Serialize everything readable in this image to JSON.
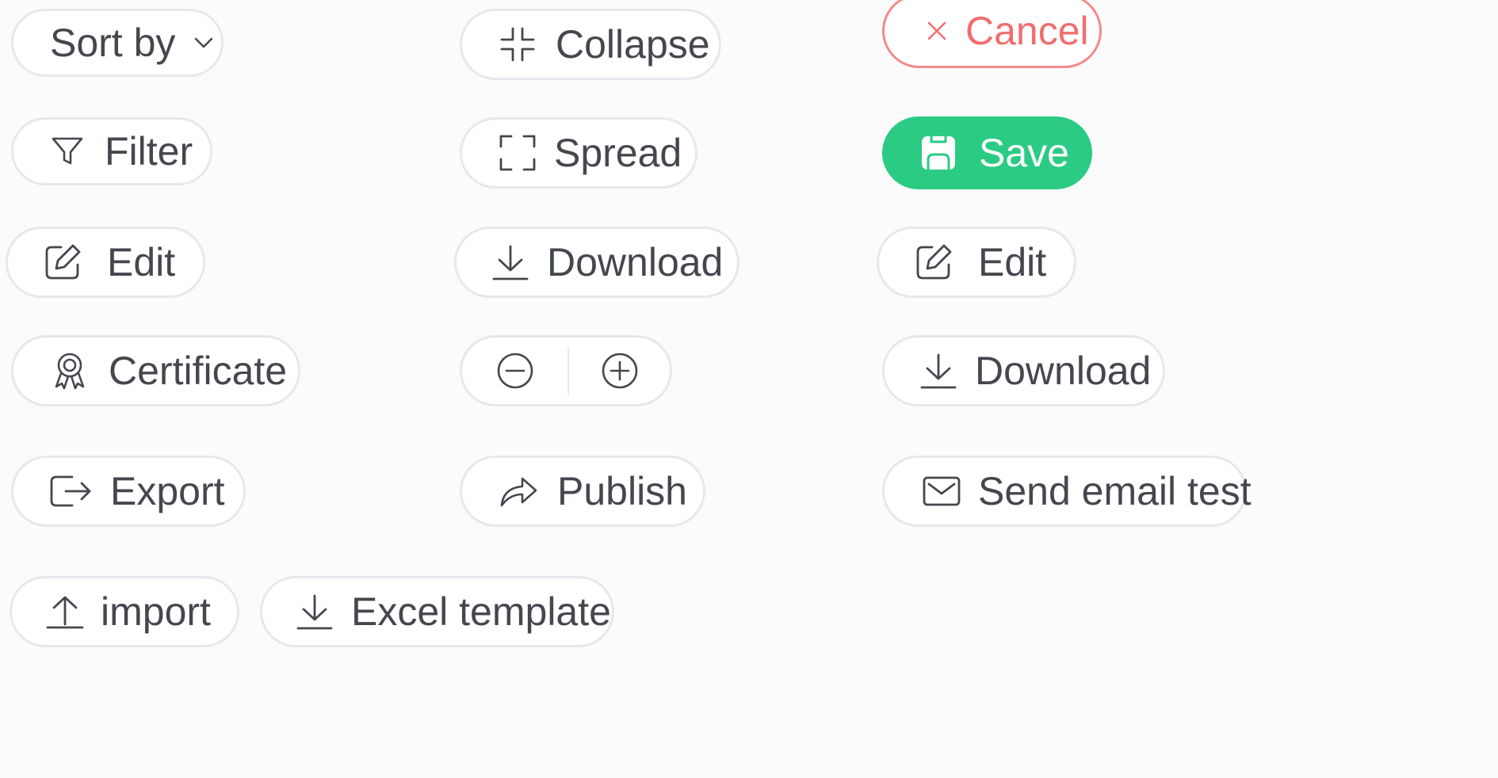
{
  "buttons": {
    "sort_by": "Sort by",
    "collapse": "Collapse",
    "cancel": "Cancel",
    "filter": "Filter",
    "spread": "Spread",
    "save": "Save",
    "edit_left": "Edit",
    "download_center": "Download",
    "edit_right": "Edit",
    "certificate": "Certificate",
    "download_right": "Download",
    "export": "Export",
    "publish": "Publish",
    "send_email_test": "Send email test",
    "import": "import",
    "excel_template": "Excel template"
  },
  "colors": {
    "background": "#fbfbfc",
    "border": "#e7e8ee",
    "text": "#45474f",
    "danger": "#f26d6d",
    "primary": "#2bcb83"
  },
  "icons": {
    "sort_by": "chevron-down-icon",
    "collapse": "collapse-icon",
    "cancel": "close-icon",
    "filter": "filter-icon",
    "spread": "expand-icon",
    "save": "save-icon",
    "edit": "edit-icon",
    "download": "download-icon",
    "certificate": "award-icon",
    "zoom_out": "zoom-out-icon",
    "zoom_in": "zoom-in-icon",
    "export": "export-icon",
    "publish": "share-icon",
    "send_email_test": "mail-icon",
    "import": "upload-icon"
  }
}
